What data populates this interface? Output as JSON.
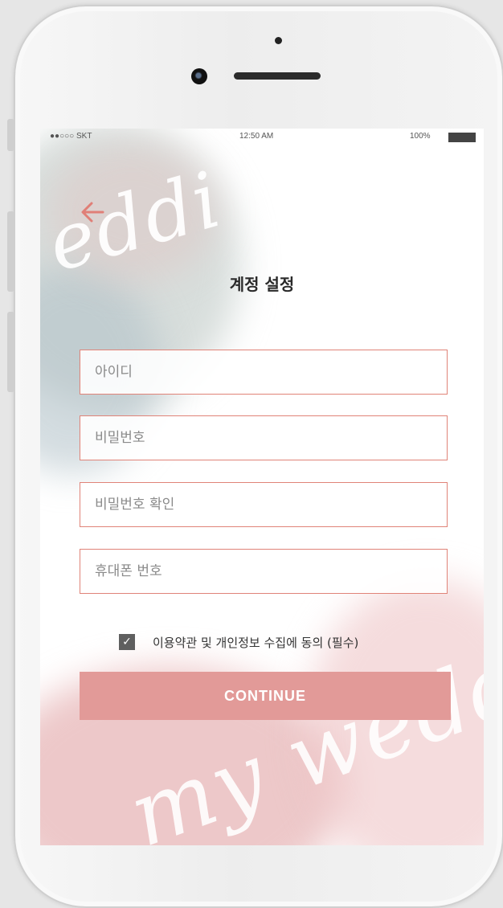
{
  "status_bar": {
    "carrier": "●●○○○ SKT",
    "time": "12:50 AM",
    "battery": "100%"
  },
  "decor": {
    "script_top": "eddi",
    "script_bottom": "my weddi"
  },
  "header": {
    "back_icon": "arrow-left-icon",
    "title": "계정 설정"
  },
  "form": {
    "fields": [
      {
        "placeholder": "아이디",
        "value": ""
      },
      {
        "placeholder": "비밀번호",
        "value": ""
      },
      {
        "placeholder": "비밀번호 확인",
        "value": ""
      },
      {
        "placeholder": "휴대폰 번호",
        "value": ""
      }
    ],
    "agreement": {
      "checked": true,
      "label": "이용약관 및 개인정보 수집에 동의 (필수)"
    },
    "continue_label": "CONTINUE"
  },
  "colors": {
    "accent": "#e08378",
    "button": "#e29a98",
    "text": "#2a2a2a"
  }
}
